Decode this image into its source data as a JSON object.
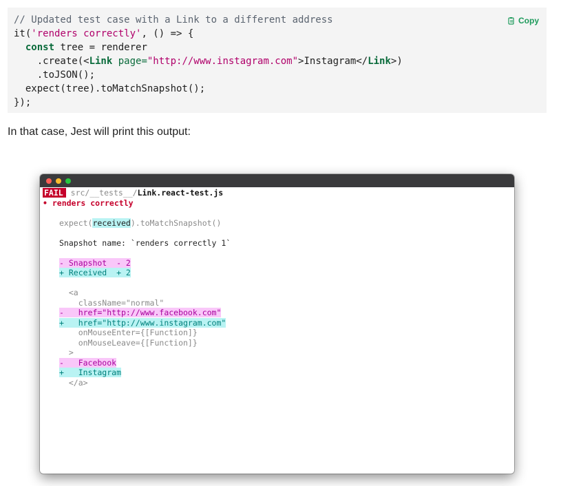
{
  "code": {
    "line1": "// Updated test case with a Link to a different address",
    "line2_fn": "it(",
    "line2_str": "'renders correctly'",
    "line2_rest": ", () => {",
    "line3_kw": "const",
    "line3_rest": " tree = renderer",
    "line4_pre": "    .create(<",
    "line4_tag": "Link",
    "line4_attr": " page=",
    "line4_str": "\"http://www.instagram.com\"",
    "line4_mid": ">Instagram</",
    "line4_tag2": "Link",
    "line4_end": ">)",
    "line5": "    .toJSON();",
    "line6": "  expect(tree).toMatchSnapshot();",
    "line7": "});"
  },
  "copy_label": "Copy",
  "paragraph": "In that case, Jest will print this output:",
  "terminal": {
    "fail_badge": "FAIL",
    "path_dim": "src/__tests__/",
    "path_file": "Link.react-test.js",
    "test_name": "• renders correctly",
    "expect_pre": "expect(",
    "expect_received": "received",
    "expect_post": ").toMatchSnapshot()",
    "snapshot_name": "Snapshot name: `renders correctly 1`",
    "snapshot_line": "- Snapshot  - 2",
    "received_line": "+ Received  + 2",
    "open_tag": "  <a",
    "classname": "    className=\"normal\"",
    "href_old": "-   href=\"http://www.facebook.com\"",
    "href_new": "+   href=\"http://www.instagram.com\"",
    "mouse_enter": "    onMouseEnter={[Function]}",
    "mouse_leave": "    onMouseLeave={[Function]}",
    "close_bracket": "  >",
    "text_old": "-   Facebook",
    "text_new": "+   Instagram",
    "close_tag": "  </a>"
  },
  "colors": {
    "fail": "#c5002b",
    "copy": "#1d9a5b",
    "received_highlight": "#b9f3f3",
    "snapshot_highlight": "#f9c7f9"
  },
  "icons": {
    "copy": "clipboard-icon"
  }
}
